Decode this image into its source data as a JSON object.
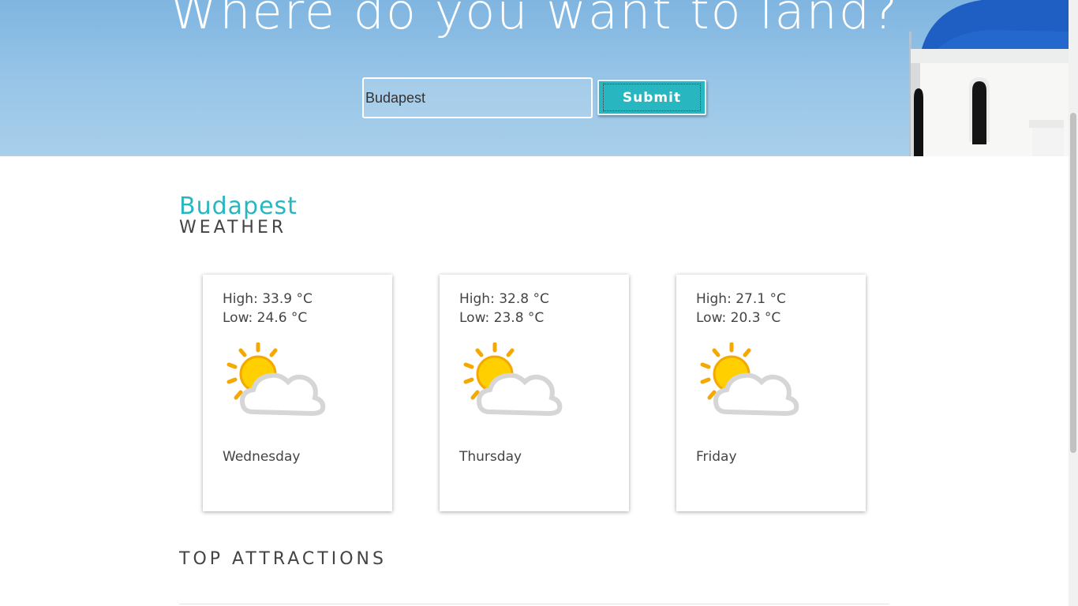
{
  "hero": {
    "title": "Where do you want to land?",
    "search_value": "Budapest",
    "submit_label": "Submit"
  },
  "weather": {
    "city": "Budapest",
    "label": "WEATHER",
    "days": [
      {
        "high": "High: 33.9 °C",
        "low": "Low: 24.6 °C",
        "day": "Wednesday",
        "icon": "partly-cloudy-icon"
      },
      {
        "high": "High: 32.8 °C",
        "low": "Low: 23.8 °C",
        "day": "Thursday",
        "icon": "partly-cloudy-icon"
      },
      {
        "high": "High: 27.1 °C",
        "low": "Low: 20.3 °C",
        "day": "Friday",
        "icon": "partly-cloudy-icon"
      }
    ]
  },
  "attractions": {
    "label": "TOP ATTRACTIONS"
  },
  "colors": {
    "accent": "#28b6c1",
    "sky": "#8fc0e6",
    "dome": "#1f5fc4"
  }
}
